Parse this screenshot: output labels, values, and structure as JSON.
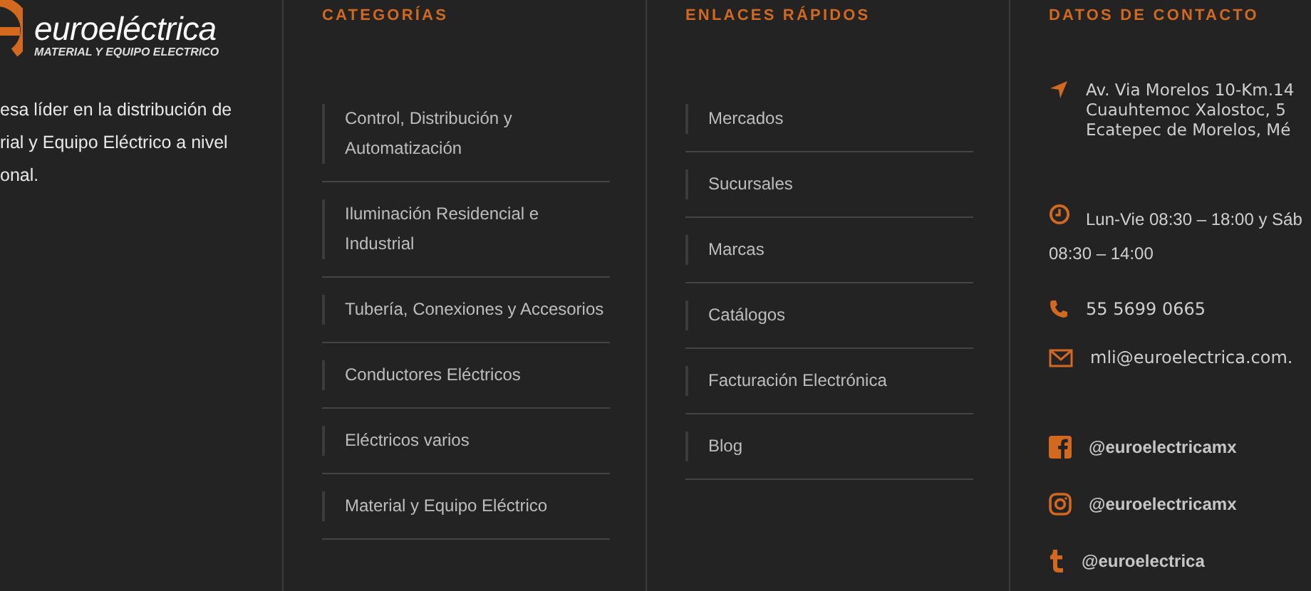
{
  "brand": {
    "name": "euroeléctrica",
    "tagline": "MATERIAL Y EQUIPO ELECTRICO",
    "intro_lines": [
      "esa líder en la distribución de",
      "rial y Equipo Eléctrico a nivel",
      "onal."
    ]
  },
  "categories": {
    "title": "CATEGORÍAS",
    "items": [
      {
        "label": "Control, Distribución y Automatización"
      },
      {
        "label": "Iluminación Residencial e Industrial"
      },
      {
        "label": "Tubería, Conexiones y Accesorios"
      },
      {
        "label": "Conductores Eléctricos"
      },
      {
        "label": "Eléctricos varios"
      },
      {
        "label": "Material y Equipo Eléctrico"
      }
    ]
  },
  "quick_links": {
    "title": "ENLACES RÁPIDOS",
    "items": [
      {
        "label": "Mercados"
      },
      {
        "label": "Sucursales"
      },
      {
        "label": "Marcas"
      },
      {
        "label": "Catálogos"
      },
      {
        "label": "Facturación Electrónica"
      },
      {
        "label": "Blog"
      }
    ]
  },
  "contact": {
    "title": "DATOS DE CONTACTO",
    "items": [
      {
        "kind": "address",
        "lines": [
          "Av. Via Morelos 10-Km.14",
          "Cuauhtemoc Xalostoc, 5",
          "Ecatepec de Morelos, Mé"
        ]
      },
      {
        "kind": "hours",
        "lines": [
          "Lun-Vie 08:30 – 18:00 y Sáb",
          "08:30 – 14:00"
        ]
      },
      {
        "kind": "phone",
        "text": "55 5699 0665"
      },
      {
        "kind": "email",
        "text": "mli@euroelectrica.com."
      }
    ],
    "social": [
      {
        "kind": "facebook",
        "handle": "@euroelectricamx"
      },
      {
        "kind": "instagram",
        "handle": "@euroelectricamx"
      },
      {
        "kind": "tumblr",
        "handle": "@euroelectrica"
      }
    ]
  }
}
